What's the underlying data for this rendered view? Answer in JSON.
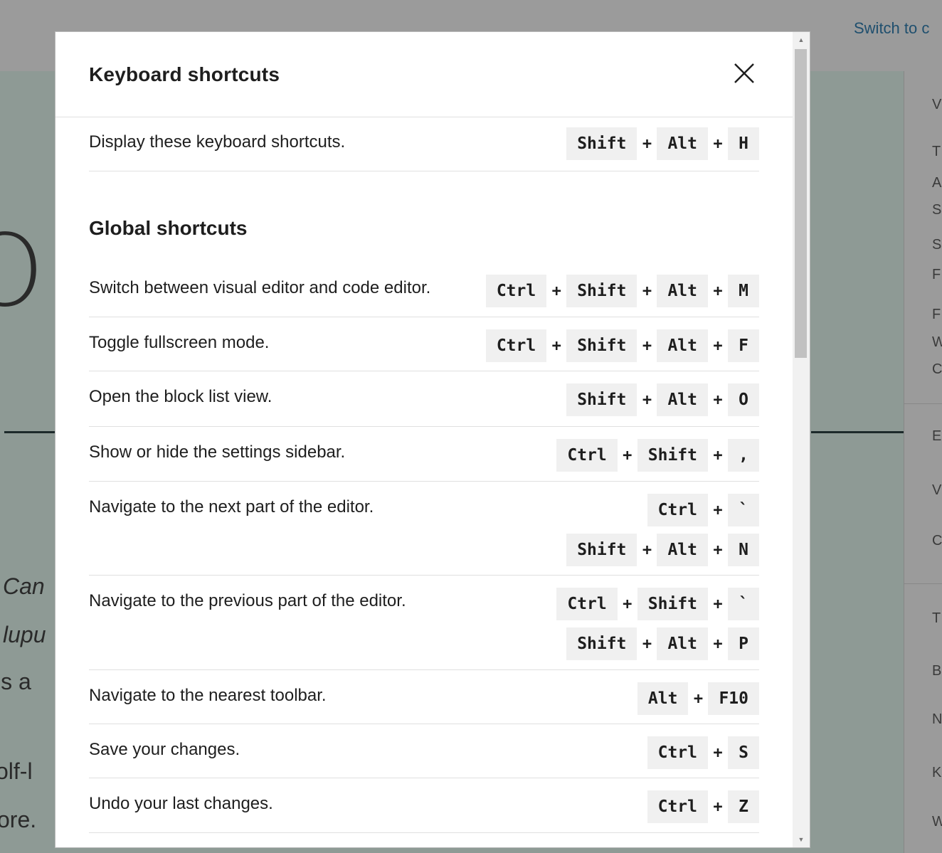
{
  "background": {
    "switch_link": "Switch to c",
    "big_letter": "O",
    "texts": [
      "Can",
      "lupu",
      "is a",
      "olf-l",
      "ore."
    ],
    "side_letters": [
      "V",
      "T",
      "A",
      "S",
      "S",
      "F",
      "F",
      "W",
      "C",
      "E",
      "V",
      "C",
      "T",
      "B",
      "N",
      "K",
      "W"
    ]
  },
  "modal": {
    "title": "Keyboard shortcuts",
    "close_label": "Close",
    "intro": {
      "description": "Display these keyboard shortcuts.",
      "keys": [
        "Shift",
        "Alt",
        "H"
      ]
    },
    "sections": [
      {
        "title": "Global shortcuts",
        "shortcuts": [
          {
            "description": "Switch between visual editor and code editor.",
            "combos": [
              [
                "Ctrl",
                "Shift",
                "Alt",
                "M"
              ]
            ]
          },
          {
            "description": "Toggle fullscreen mode.",
            "combos": [
              [
                "Ctrl",
                "Shift",
                "Alt",
                "F"
              ]
            ]
          },
          {
            "description": "Open the block list view.",
            "combos": [
              [
                "Shift",
                "Alt",
                "O"
              ]
            ]
          },
          {
            "description": "Show or hide the settings sidebar.",
            "combos": [
              [
                "Ctrl",
                "Shift",
                ","
              ]
            ]
          },
          {
            "description": "Navigate to the next part of the editor.",
            "combos": [
              [
                "Ctrl",
                "`"
              ],
              [
                "Shift",
                "Alt",
                "N"
              ]
            ]
          },
          {
            "description": "Navigate to the previous part of the editor.",
            "combos": [
              [
                "Ctrl",
                "Shift",
                "`"
              ],
              [
                "Shift",
                "Alt",
                "P"
              ]
            ]
          },
          {
            "description": "Navigate to the nearest toolbar.",
            "combos": [
              [
                "Alt",
                "F10"
              ]
            ]
          },
          {
            "description": "Save your changes.",
            "combos": [
              [
                "Ctrl",
                "S"
              ]
            ]
          },
          {
            "description": "Undo your last changes.",
            "combos": [
              [
                "Ctrl",
                "Z"
              ]
            ]
          }
        ]
      }
    ],
    "plus_sign": "+"
  },
  "colors": {
    "overlay_bg": "#8e9a95",
    "key_bg": "#f0f0f0",
    "link": "#1f4f6e",
    "text": "#1e1e1e",
    "divider": "#e0e0e0"
  }
}
